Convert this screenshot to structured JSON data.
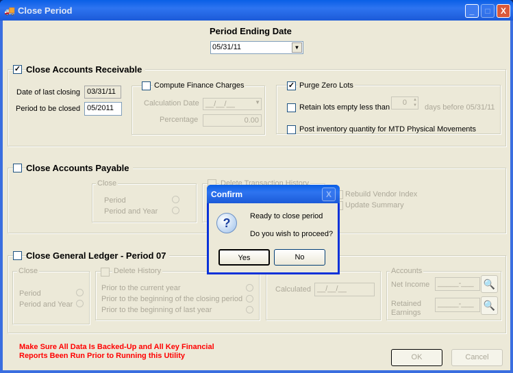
{
  "window": {
    "title": "Close Period",
    "controls": {
      "minimize": "_",
      "maximize": "□",
      "close": "X"
    }
  },
  "period_ending": {
    "label": "Period Ending Date",
    "value": "05/31/11"
  },
  "ar": {
    "title": "Close Accounts Receivable",
    "checked": true,
    "date_last_closing_label": "Date of last closing",
    "date_last_closing": "03/31/11",
    "period_to_close_label": "Period to be closed",
    "period_to_close": "05/2011",
    "finance": {
      "label": "Compute Finance Charges",
      "checked": false,
      "calc_date_label": "Calculation Date",
      "calc_date": "__/__/__",
      "percentage_label": "Percentage",
      "percentage": "0.00"
    },
    "purge": {
      "label": "Purge Zero Lots",
      "checked": true,
      "retain_label": "Retain lots empty less than",
      "retain_days": "0",
      "days_before_label": "days before 05/31/11"
    },
    "post_inventory_label": "Post inventory quantity for MTD Physical Movements"
  },
  "ap": {
    "title": "Close Accounts Payable",
    "checked": false,
    "close_group": "Close",
    "period": "Period",
    "period_year": "Period and Year",
    "delete_history": "Delete Transaction History",
    "rebuild_vendor": "Rebuild Vendor Index",
    "update_summary": "Update Summary"
  },
  "gl": {
    "title": "Close General Ledger - Period 07",
    "checked": false,
    "close_group": "Close",
    "period": "Period",
    "period_year": "Period and Year",
    "delete_history": "Delete History",
    "options": [
      "Prior to the current year",
      "Prior to the beginning of the closing period",
      "Prior to the beginning of last year"
    ],
    "calculated_label": "Calculated",
    "calculated": "__/__/__",
    "accounts_label": "Accounts",
    "net_income_label": "Net Income",
    "net_income": "_____-___",
    "retained_label_1": "Retained",
    "retained_label_2": "Earnings",
    "retained": "_____-___"
  },
  "warning": {
    "line1": "Make Sure All Data Is Backed-Up and All Key Financial",
    "line2": "Reports Been Run Prior to Running this Utility",
    "color": "#ff0000"
  },
  "buttons": {
    "ok": "OK",
    "cancel": "Cancel"
  },
  "dialog": {
    "title": "Confirm",
    "message1": "Ready to close period",
    "message2": "Do you wish to proceed?",
    "yes": "Yes",
    "no": "No",
    "close": "X"
  }
}
